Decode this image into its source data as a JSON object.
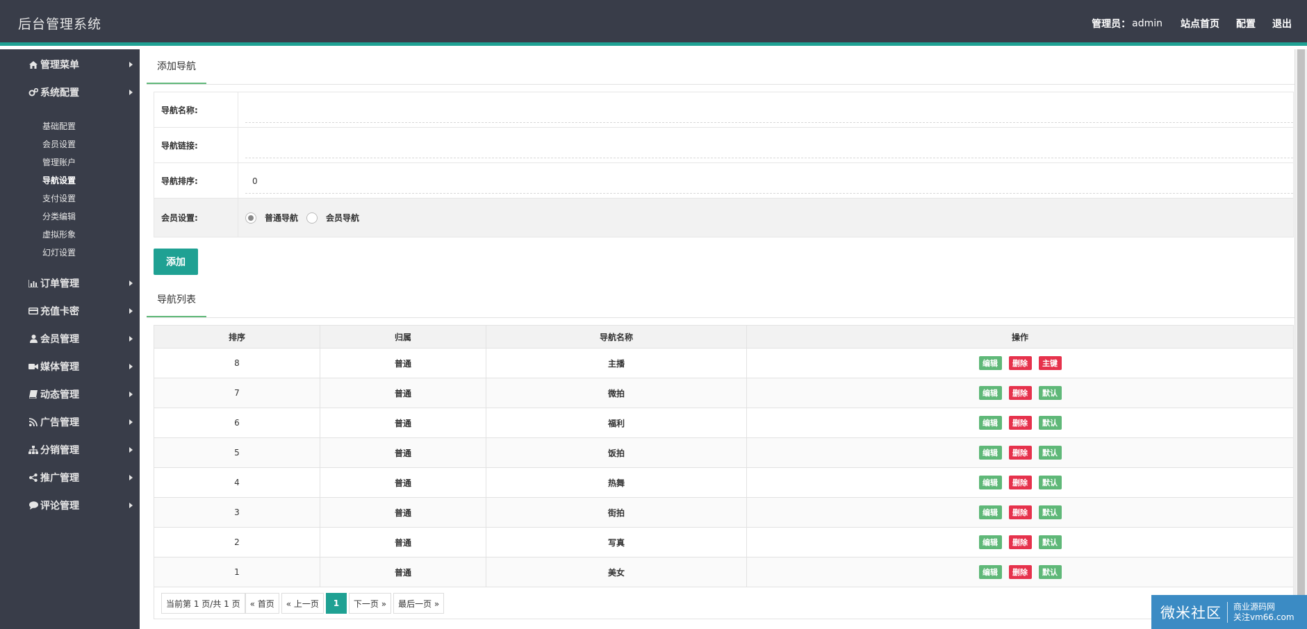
{
  "header": {
    "title": "后台管理系统",
    "admin_label": "管理员：",
    "admin_name": "admin",
    "links": [
      "站点首页",
      "配置",
      "退出"
    ]
  },
  "sidebar": {
    "menus": [
      {
        "label": "管理菜单",
        "icon": "home-icon"
      },
      {
        "label": "系统配置",
        "icon": "gears-icon"
      },
      {
        "label": "订单管理",
        "icon": "bar-chart-icon"
      },
      {
        "label": "充值卡密",
        "icon": "credit-card-icon"
      },
      {
        "label": "会员管理",
        "icon": "user-icon"
      },
      {
        "label": "媒体管理",
        "icon": "video-camera-icon"
      },
      {
        "label": "动态管理",
        "icon": "book-icon"
      },
      {
        "label": "广告管理",
        "icon": "rss-icon"
      },
      {
        "label": "分销管理",
        "icon": "sitemap-icon"
      },
      {
        "label": "推广管理",
        "icon": "share-icon"
      },
      {
        "label": "评论管理",
        "icon": "comment-icon"
      }
    ],
    "submenu": [
      "基础配置",
      "会员设置",
      "管理账户",
      "导航设置",
      "支付设置",
      "分类编辑",
      "虚拟形象",
      "幻灯设置"
    ],
    "active_sub": "导航设置"
  },
  "add_section": {
    "tab_title": "添加导航",
    "fields": {
      "name_label": "导航名称:",
      "name_value": "",
      "link_label": "导航链接:",
      "link_value": "",
      "order_label": "导航排序:",
      "order_value": "0",
      "member_label": "会员设置:"
    },
    "radio_options": [
      "普通导航",
      "会员导航"
    ],
    "radio_selected": "普通导航",
    "add_button": "添加"
  },
  "list_section": {
    "tab_title": "导航列表",
    "columns": [
      "排序",
      "归属",
      "导航名称",
      "操作"
    ],
    "rows": [
      {
        "order": "8",
        "owner": "普通",
        "name": "主播",
        "third": "主键"
      },
      {
        "order": "7",
        "owner": "普通",
        "name": "微拍",
        "third": "默认"
      },
      {
        "order": "6",
        "owner": "普通",
        "name": "福利",
        "third": "默认"
      },
      {
        "order": "5",
        "owner": "普通",
        "name": "饭拍",
        "third": "默认"
      },
      {
        "order": "4",
        "owner": "普通",
        "name": "热舞",
        "third": "默认"
      },
      {
        "order": "3",
        "owner": "普通",
        "name": "街拍",
        "third": "默认"
      },
      {
        "order": "2",
        "owner": "普通",
        "name": "写真",
        "third": "默认"
      },
      {
        "order": "1",
        "owner": "普通",
        "name": "美女",
        "third": "默认"
      }
    ],
    "ops": {
      "edit": "编辑",
      "delete": "删除"
    },
    "colors": {
      "green": "#5fb878",
      "red": "#e6324c"
    }
  },
  "pager": {
    "info": "当前第 1 页/共 1 页",
    "first": "« 首页",
    "prev": "« 上一页",
    "current": "1",
    "next": "下一页 »",
    "last": "最后一页 »"
  },
  "watermark": {
    "main": "微米社区",
    "sub1": "商业源码网",
    "sub2": "关注vm66.com"
  },
  "colors": {
    "accent": "#1fa193",
    "header_bg": "#393d49",
    "tab_underline": "#5fb878"
  }
}
